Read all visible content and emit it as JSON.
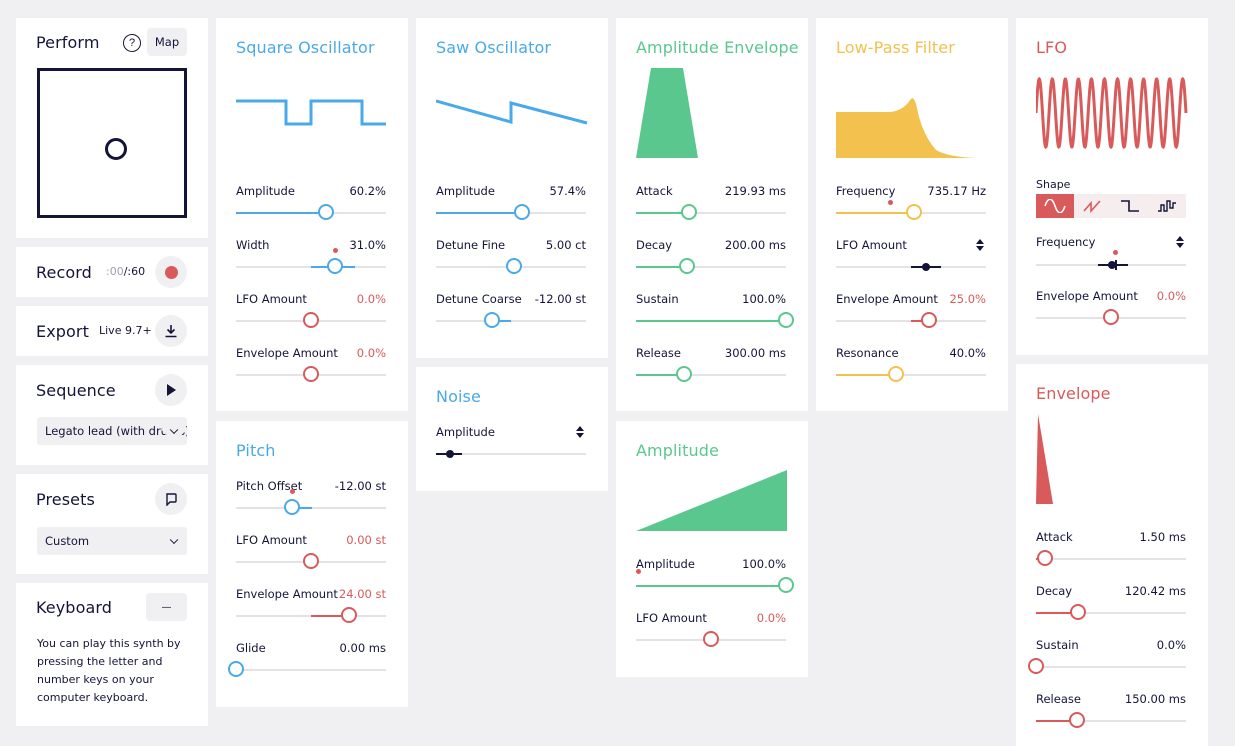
{
  "perform": {
    "title": "Perform",
    "help": "?",
    "map": "Map"
  },
  "record": {
    "title": "Record",
    "time_elapsed": ":00",
    "time_total": "/:60"
  },
  "export": {
    "title": "Export",
    "version": "Live 9.7+"
  },
  "sequence": {
    "title": "Sequence",
    "selected": "Legato lead (with drums)"
  },
  "presets": {
    "title": "Presets",
    "selected": "Custom"
  },
  "keyboard": {
    "title": "Keyboard",
    "toggle": "—",
    "text": "You can play this synth by pressing the letter and number keys on your computer keyboard."
  },
  "square_osc": {
    "title": "Square Oscillator",
    "amplitude": {
      "label": "Amplitude",
      "value": "60.2%",
      "level": 0.6
    },
    "width": {
      "label": "Width",
      "value": "31.0%",
      "level": 0.66
    },
    "lfo": {
      "label": "LFO Amount",
      "value": "0.0%",
      "level": 0.5
    },
    "env": {
      "label": "Envelope Amount",
      "value": "0.0%",
      "level": 0.5
    }
  },
  "saw_osc": {
    "title": "Saw Oscillator",
    "amplitude": {
      "label": "Amplitude",
      "value": "57.4%",
      "level": 0.57
    },
    "detune_fine": {
      "label": "Detune Fine",
      "value": "5.00 ct",
      "level": 0.52
    },
    "detune_coarse": {
      "label": "Detune Coarse",
      "value": "-12.00 st",
      "level": 0.37
    }
  },
  "noise": {
    "title": "Noise",
    "amplitude": {
      "label": "Amplitude"
    }
  },
  "pitch": {
    "title": "Pitch",
    "offset": {
      "label": "Pitch Offset",
      "value": "-12.00 st",
      "level": 0.37
    },
    "lfo": {
      "label": "LFO Amount",
      "value": "0.00 st",
      "level": 0.5
    },
    "env": {
      "label": "Envelope Amount",
      "value": "24.00 st",
      "level": 0.75
    },
    "glide": {
      "label": "Glide",
      "value": "0.00 ms",
      "level": 0.0
    }
  },
  "amp_env": {
    "title": "Amplitude Envelope",
    "attack": {
      "label": "Attack",
      "value": "219.93 ms",
      "level": 0.35
    },
    "decay": {
      "label": "Decay",
      "value": "200.00 ms",
      "level": 0.34
    },
    "sustain": {
      "label": "Sustain",
      "value": "100.0%",
      "level": 1.0
    },
    "release": {
      "label": "Release",
      "value": "300.00 ms",
      "level": 0.32
    }
  },
  "amplitude": {
    "title": "Amplitude",
    "amplitude": {
      "label": "Amplitude",
      "value": "100.0%",
      "level": 1.0
    },
    "lfo": {
      "label": "LFO Amount",
      "value": "0.0%",
      "level": 0.5
    }
  },
  "lpf": {
    "title": "Low-Pass Filter",
    "frequency": {
      "label": "Frequency",
      "value": "735.17 Hz",
      "level": 0.52
    },
    "lfo": {
      "label": "LFO Amount"
    },
    "env": {
      "label": "Envelope Amount",
      "value": "25.0%",
      "level": 0.62
    },
    "resonance": {
      "label": "Resonance",
      "value": "40.0%",
      "level": 0.4
    }
  },
  "lfo": {
    "title": "LFO",
    "shape": "Shape",
    "frequency": {
      "label": "Frequency"
    },
    "env": {
      "label": "Envelope Amount",
      "value": "0.0%",
      "level": 0.5
    }
  },
  "envelope": {
    "title": "Envelope",
    "attack": {
      "label": "Attack",
      "value": "1.50 ms",
      "level": 0.06
    },
    "decay": {
      "label": "Decay",
      "value": "120.42 ms",
      "level": 0.28
    },
    "sustain": {
      "label": "Sustain",
      "value": "0.0%",
      "level": 0.0
    },
    "release": {
      "label": "Release",
      "value": "150.00 ms",
      "level": 0.27
    }
  },
  "colors": {
    "blue": "#4aa9e8",
    "green": "#5ac88e",
    "yellow": "#f2c14e",
    "red": "#d85a5a",
    "navy": "#14143a"
  },
  "icons": [
    "help-icon",
    "record-icon",
    "download-icon",
    "play-icon",
    "preset-save-icon",
    "chevron-down-icon",
    "up-down-icon",
    "sine-wave-icon",
    "saw-wave-icon",
    "square-wave-icon",
    "random-wave-icon"
  ]
}
